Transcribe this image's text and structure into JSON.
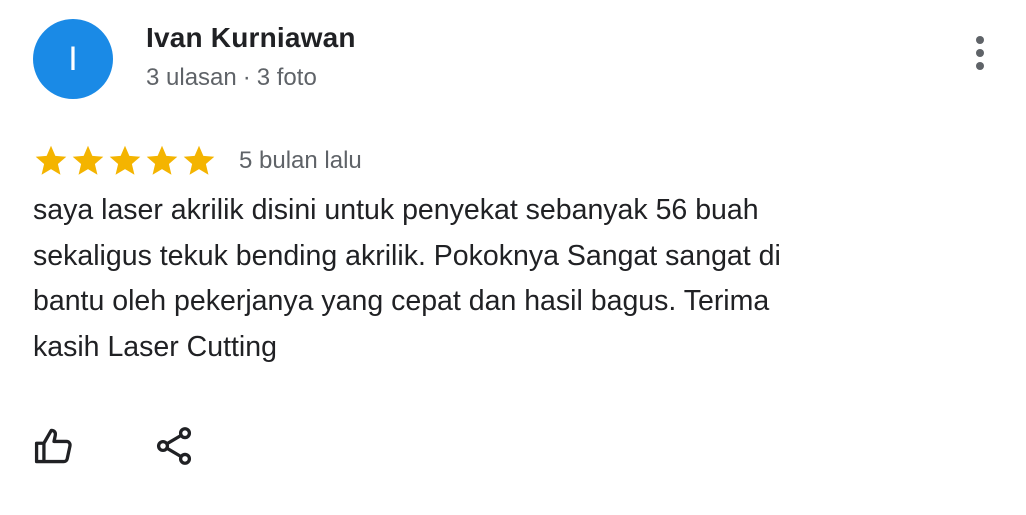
{
  "review": {
    "author": {
      "initial": "I",
      "name": "Ivan Kurniawan",
      "reviews_count": "3 ulasan",
      "separator": "·",
      "photos_count": "3 foto",
      "avatar_color": "#1a8ae6"
    },
    "rating": 5,
    "rating_max": 5,
    "star_color": "#f4b400",
    "date": "5 bulan lalu",
    "text_lines": [
      "saya laser akrilik disini untuk penyekat sebanyak 56 buah",
      "sekaligus tekuk bending akrilik. Pokoknya Sangat sangat di",
      "bantu oleh pekerjanya yang cepat dan hasil bagus. Terima",
      "kasih Laser Cutting"
    ],
    "actions": {
      "more_icon": "more-vertical-icon",
      "like_icon": "thumb-up-icon",
      "share_icon": "share-icon"
    }
  }
}
